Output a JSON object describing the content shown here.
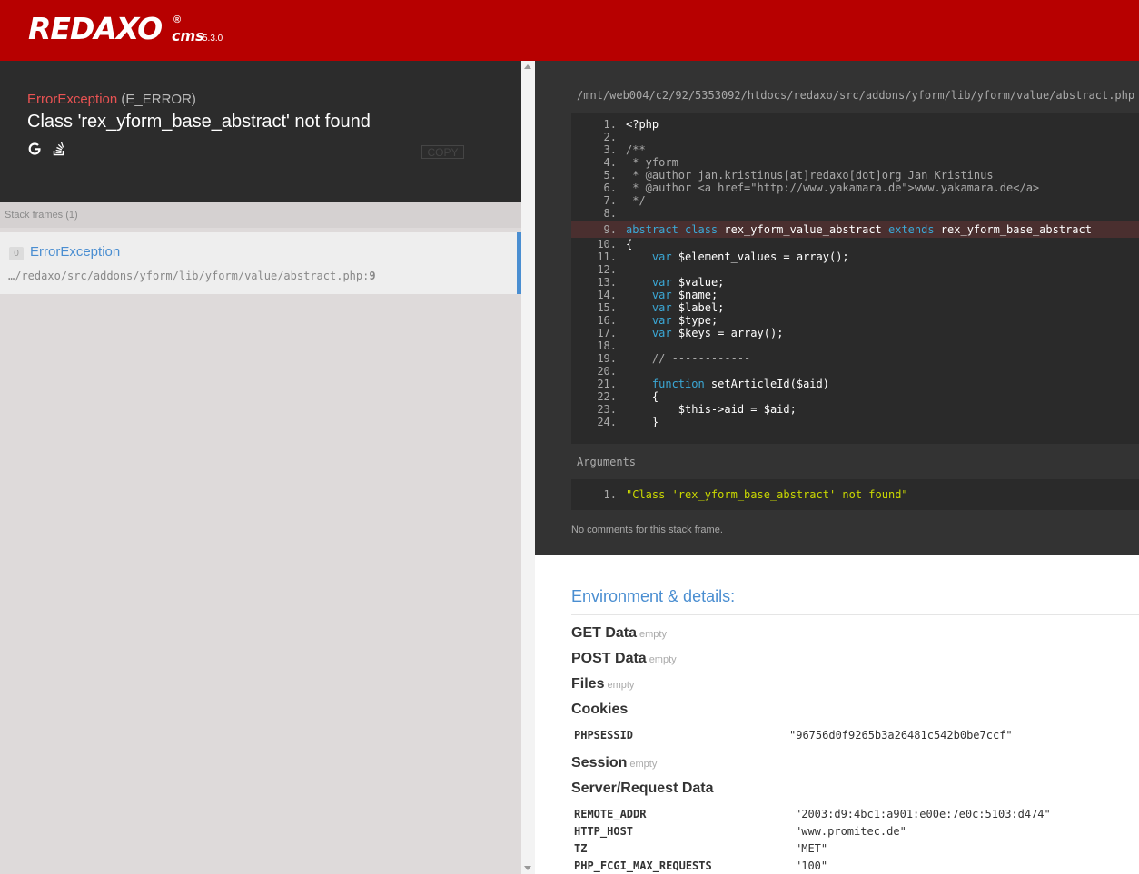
{
  "header": {
    "logo_text": "REDAXO",
    "logo_reg": "®",
    "logo_cms": "cms",
    "version": "5.3.0",
    "background_color": "#b70000"
  },
  "exception": {
    "class": "ErrorException",
    "code": "(E_ERROR)",
    "message": "Class 'rex_yform_base_abstract' not found",
    "icons": [
      "google-search-icon",
      "stackoverflow-icon"
    ],
    "copy_label": "COPY"
  },
  "stack": {
    "header": "Stack frames (1)",
    "frames": [
      {
        "index": "0",
        "class": "ErrorException",
        "file": "…/redaxo/src/addons/yform/lib/yform/value/abstract.php",
        "sep": ":",
        "line": "9"
      }
    ]
  },
  "code": {
    "file_path": "/mnt/web004/c2/92/5353092/htdocs/redaxo/src/addons/yform/lib/yform/value/abstract.php",
    "highlighted_line": "9",
    "lines": [
      {
        "n": "1.",
        "t": "<?php"
      },
      {
        "n": "2.",
        "t": ""
      },
      {
        "n": "3.",
        "t": "/**"
      },
      {
        "n": "4.",
        "t": " * yform"
      },
      {
        "n": "5.",
        "t": " * @author jan.kristinus[at]redaxo[dot]org Jan Kristinus"
      },
      {
        "n": "6.",
        "t": " * @author <a href=\"http://www.yakamara.de\">www.yakamara.de</a>"
      },
      {
        "n": "7.",
        "t": " */"
      },
      {
        "n": "8.",
        "t": ""
      },
      {
        "n": "9.",
        "t": "abstract class rex_yform_value_abstract extends rex_yform_base_abstract"
      },
      {
        "n": "10.",
        "t": "{"
      },
      {
        "n": "11.",
        "t": "    var $element_values = array();"
      },
      {
        "n": "12.",
        "t": ""
      },
      {
        "n": "13.",
        "t": "    var $value;"
      },
      {
        "n": "14.",
        "t": "    var $name;"
      },
      {
        "n": "15.",
        "t": "    var $label;"
      },
      {
        "n": "16.",
        "t": "    var $type;"
      },
      {
        "n": "17.",
        "t": "    var $keys = array();"
      },
      {
        "n": "18.",
        "t": ""
      },
      {
        "n": "19.",
        "t": "    // ------------"
      },
      {
        "n": "20.",
        "t": ""
      },
      {
        "n": "21.",
        "t": "    function setArticleId($aid)"
      },
      {
        "n": "22.",
        "t": "    {"
      },
      {
        "n": "23.",
        "t": "        $this->aid = $aid;"
      },
      {
        "n": "24.",
        "t": "    }"
      }
    ],
    "arguments_label": "Arguments",
    "arguments": [
      {
        "n": "1.",
        "v": "\"Class 'rex_yform_base_abstract' not found\""
      }
    ],
    "no_comments": "No comments for this stack frame."
  },
  "environment": {
    "title": "Environment & details:",
    "get": {
      "label": "GET Data",
      "note": "empty"
    },
    "post": {
      "label": "POST Data",
      "note": "empty"
    },
    "files": {
      "label": "Files",
      "note": "empty"
    },
    "cookies": {
      "label": "Cookies",
      "rows": [
        {
          "key": "PHPSESSID",
          "value": "\"96756d0f9265b3a26481c542b0be7ccf\""
        }
      ]
    },
    "session": {
      "label": "Session",
      "note": "empty"
    },
    "server": {
      "label": "Server/Request Data",
      "rows": [
        {
          "key": "REMOTE_ADDR",
          "value": "\"2003:d9:4bc1:a901:e00e:7e0c:5103:d474\""
        },
        {
          "key": "HTTP_HOST",
          "value": "\"www.promitec.de\""
        },
        {
          "key": "TZ",
          "value": "\"MET\""
        },
        {
          "key": "PHP_FCGI_MAX_REQUESTS",
          "value": "\"100\""
        }
      ]
    }
  }
}
